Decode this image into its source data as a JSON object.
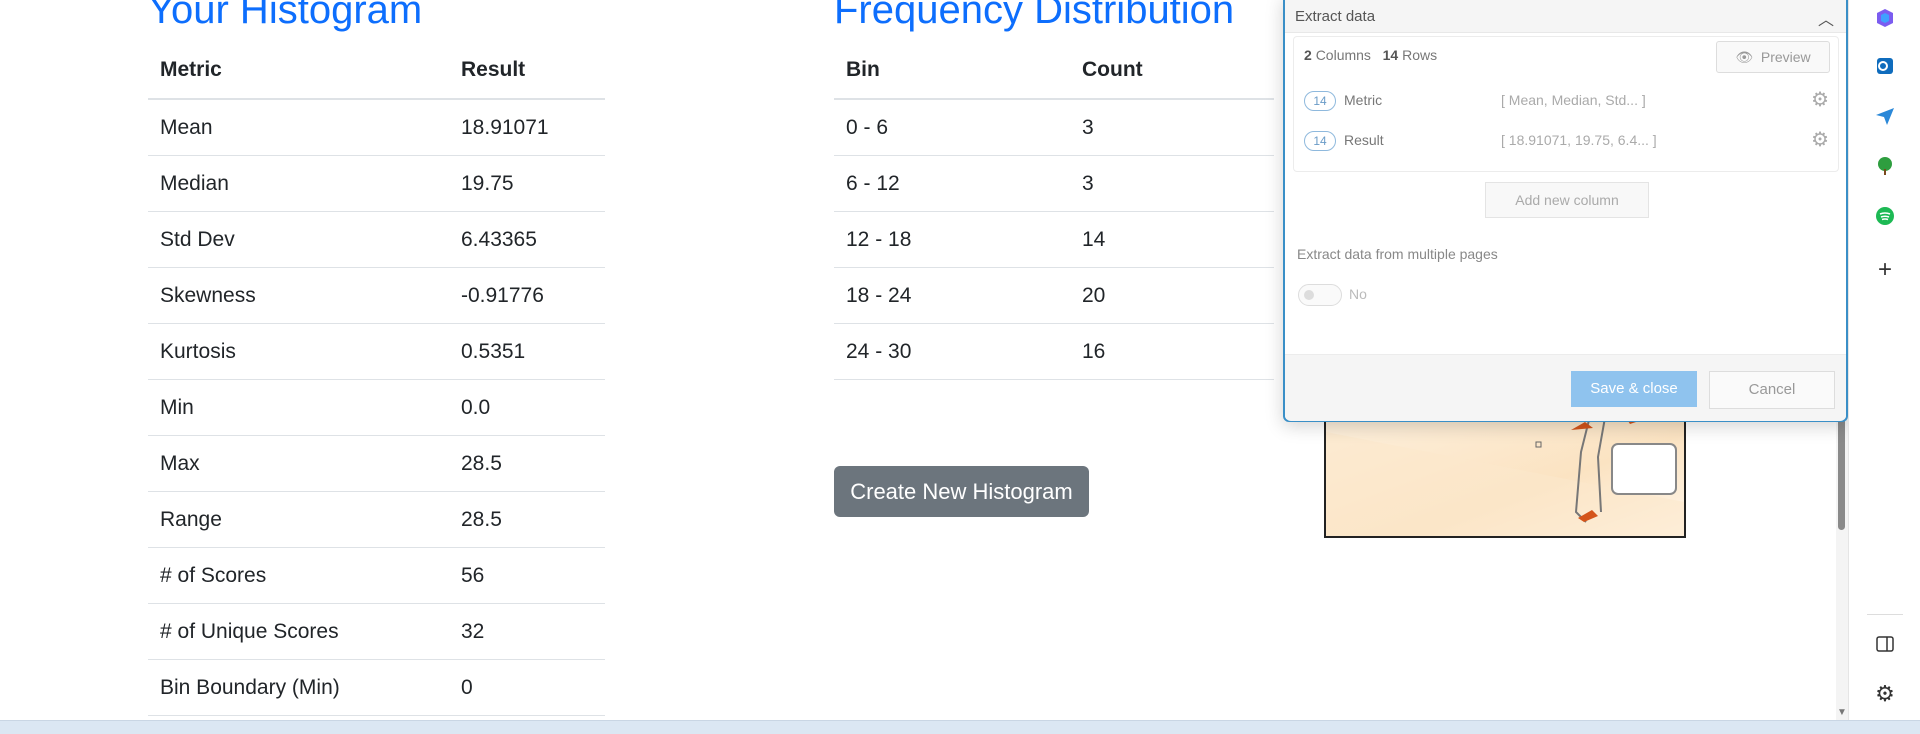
{
  "histogram": {
    "title": "Your Histogram",
    "headers": [
      "Metric",
      "Result"
    ],
    "rows": [
      [
        "Mean",
        "18.91071"
      ],
      [
        "Median",
        "19.75"
      ],
      [
        "Std Dev",
        "6.43365"
      ],
      [
        "Skewness",
        "-0.91776"
      ],
      [
        "Kurtosis",
        "0.5351"
      ],
      [
        "Min",
        "0.0"
      ],
      [
        "Max",
        "28.5"
      ],
      [
        "Range",
        "28.5"
      ],
      [
        "# of Scores",
        "56"
      ],
      [
        "# of Unique Scores",
        "32"
      ],
      [
        "Bin Boundary (Min)",
        "0"
      ]
    ]
  },
  "frequency": {
    "title": "Frequency Distribution",
    "headers": [
      "Bin",
      "Count"
    ],
    "rows": [
      [
        "0 - 6",
        "3"
      ],
      [
        "6 - 12",
        "3"
      ],
      [
        "12 - 18",
        "14"
      ],
      [
        "18 - 24",
        "20"
      ],
      [
        "24 - 30",
        "16"
      ]
    ]
  },
  "create_button": "Create New Histogram",
  "panel": {
    "title": "Extract data",
    "columns_count": "2",
    "columns_label": "Columns",
    "rows_count": "14",
    "rows_label": "Rows",
    "preview_label": "Preview",
    "columns": [
      {
        "count": "14",
        "name": "Metric",
        "preview": "[ Mean, Median, Std... ]"
      },
      {
        "count": "14",
        "name": "Result",
        "preview": "[ 18.91071, 19.75, 6.4... ]"
      }
    ],
    "add_column_label": "Add new column",
    "multi_page_label": "Extract data from multiple pages",
    "multi_page_value": "No",
    "save_label": "Save & close",
    "cancel_label": "Cancel"
  },
  "sidebar_icons": [
    "copilot-icon",
    "outlook-icon",
    "send-icon",
    "tree-icon",
    "spotify-icon",
    "add-icon",
    "split-view-icon",
    "settings-icon"
  ]
}
